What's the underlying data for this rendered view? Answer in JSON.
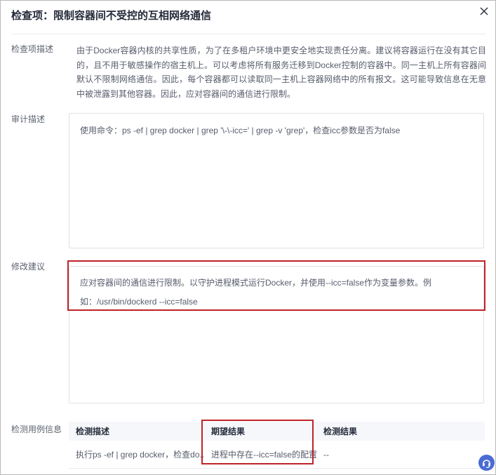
{
  "dialog": {
    "title": "检查项：限制容器间不受控的互相网络通信"
  },
  "sections": {
    "check_item_desc": {
      "label": "检查项描述",
      "content": "由于Docker容器内核的共享性质，为了在多租户环境中更安全地实现责任分离。建议将容器运行在没有其它目的，且不用于敏感操作的宿主机上。可以考虑将所有服务迁移到Docker控制的容器中。同一主机上所有容器间默认不限制网络通信。因此，每个容器都可以读取同一主机上容器网络中的所有报文。这可能导致信息在无意中被泄露到其他容器。因此，应对容器间的通信进行限制。"
    },
    "audit_desc": {
      "label": "审计描述",
      "content": "使用命令：ps -ef | grep docker | grep '\\-\\-icc=' | grep -v 'grep'，检查icc参数是否为false"
    },
    "suggestion": {
      "label": "修改建议",
      "content": "应对容器间的通信进行限制。以守护进程模式运行Docker，并使用--icc=false作为变量参数。例如：/usr/bin/dockerd --icc=false"
    },
    "test_case": {
      "label": "检测用例信息",
      "table": {
        "headers": [
          "检测描述",
          "期望结果",
          "检测结果"
        ],
        "rows": [
          [
            "执行ps -ef | grep docker，检查do...",
            "进程中存在--icc=false的配置",
            "--"
          ]
        ]
      }
    }
  },
  "annotations": {
    "highlight_color": "#bf2329"
  },
  "support_button": {
    "icon": "headset-icon",
    "color": "#4a6cd4"
  }
}
